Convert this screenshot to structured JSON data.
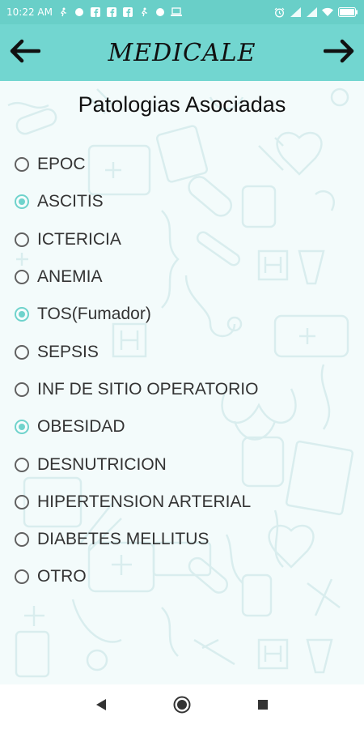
{
  "status_bar": {
    "time": "10:22 AM",
    "left_icons": [
      "walk-icon",
      "record-icon",
      "facebook-icon",
      "facebook-icon",
      "facebook-icon",
      "walk-icon",
      "record-icon",
      "laptop-icon"
    ],
    "right_icons": [
      "alarm-icon",
      "signal-icon",
      "signal-icon",
      "wifi-icon",
      "battery-icon"
    ]
  },
  "app_bar": {
    "title": "MEDICALE",
    "back_icon": "arrow-left-icon",
    "forward_icon": "arrow-right-icon"
  },
  "main": {
    "section_title": "Patologias Asociadas",
    "accent_color": "#6fd3cc",
    "options": [
      {
        "label": "EPOC",
        "checked": false
      },
      {
        "label": "ASCITIS",
        "checked": true
      },
      {
        "label": "ICTERICIA",
        "checked": false
      },
      {
        "label": "ANEMIA",
        "checked": false
      },
      {
        "label": "TOS(Fumador)",
        "checked": true
      },
      {
        "label": "SEPSIS",
        "checked": false
      },
      {
        "label": "INF DE SITIO OPERATORIO",
        "checked": false
      },
      {
        "label": "OBESIDAD",
        "checked": true
      },
      {
        "label": "DESNUTRICION",
        "checked": false
      },
      {
        "label": "HIPERTENSION ARTERIAL",
        "checked": false
      },
      {
        "label": "DIABETES MELLITUS",
        "checked": false
      },
      {
        "label": "OTRO",
        "checked": false
      }
    ]
  },
  "nav_bar": {
    "buttons": [
      "back-triangle-icon",
      "home-circle-icon",
      "recents-square-icon"
    ]
  }
}
